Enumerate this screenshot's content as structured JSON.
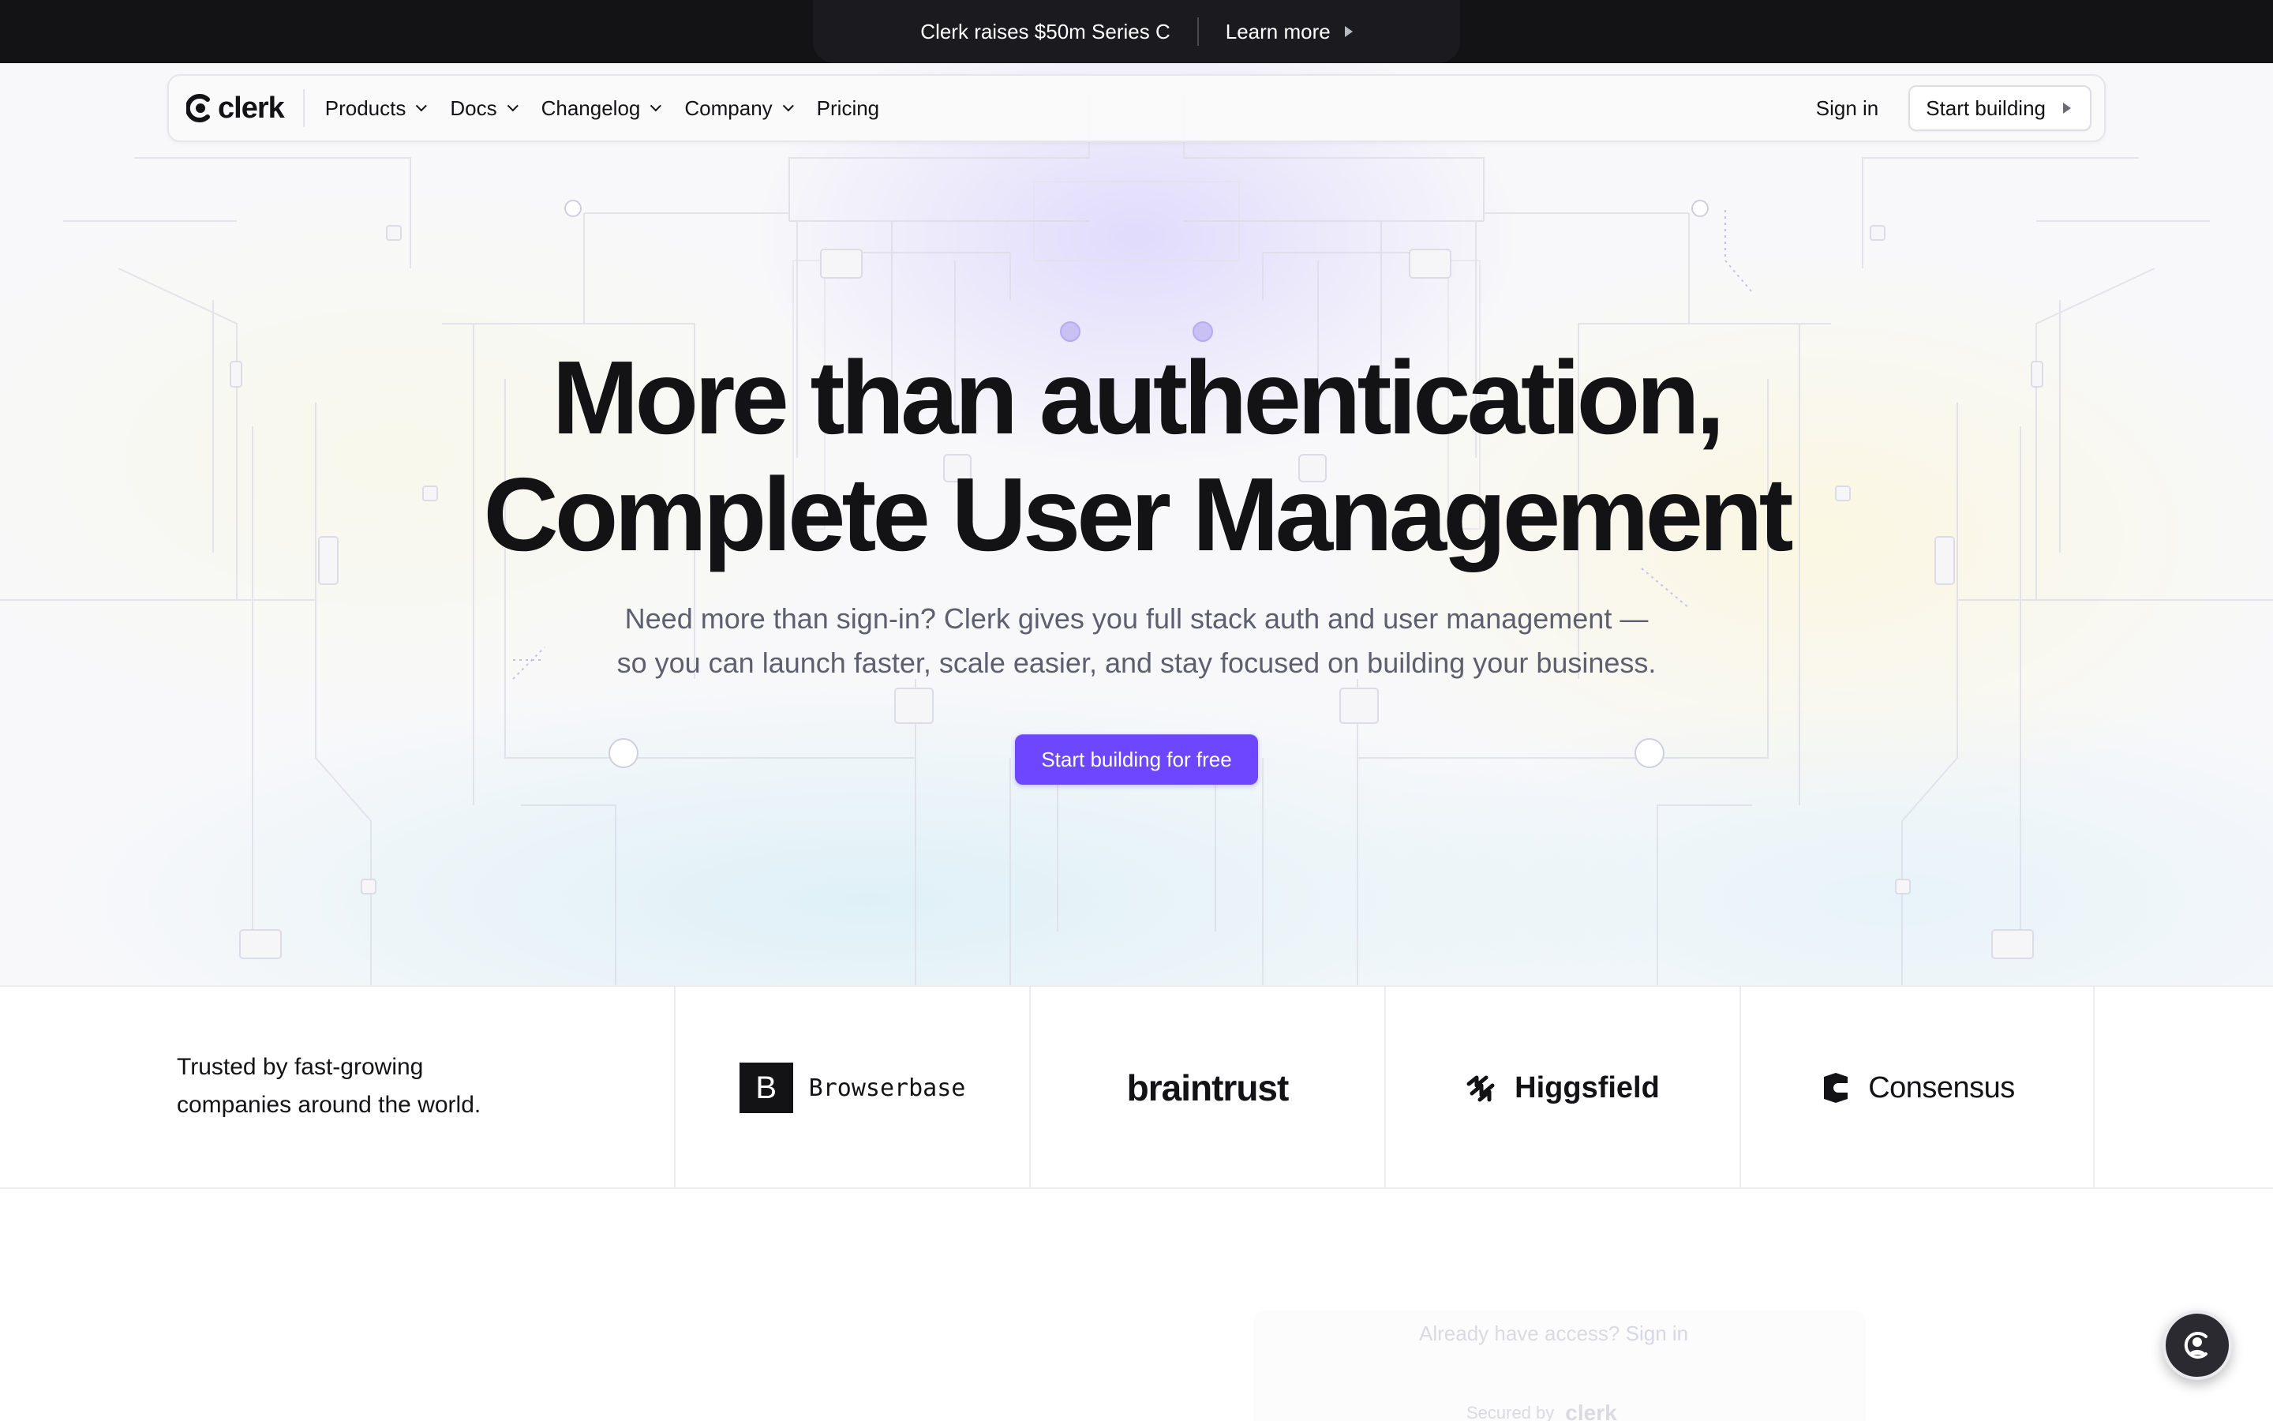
{
  "announcement": {
    "text": "Clerk raises $50m Series C",
    "link": "Learn more"
  },
  "nav": {
    "logo": "clerk",
    "items": [
      {
        "label": "Products",
        "has_menu": true
      },
      {
        "label": "Docs",
        "has_menu": true
      },
      {
        "label": "Changelog",
        "has_menu": true
      },
      {
        "label": "Company",
        "has_menu": true
      },
      {
        "label": "Pricing",
        "has_menu": false
      }
    ],
    "sign_in": "Sign in",
    "start_building": "Start building"
  },
  "hero": {
    "headline_line1": "More than authentication,",
    "headline_line2": "Complete User Management",
    "sub_line1": "Need more than sign-in? Clerk gives you full stack auth and user management —",
    "sub_line2": "so you can launch faster, scale easier, and stay focused on building your business.",
    "cta": "Start building for free"
  },
  "trusted": {
    "line1": "Trusted by fast-growing",
    "line2": "companies around the world.",
    "logos": [
      {
        "name": "Browserbase",
        "mark": "B"
      },
      {
        "name": "braintrust"
      },
      {
        "name": "Higgsfield"
      },
      {
        "name": "Consensus"
      }
    ]
  },
  "below_fold": {
    "access_text": "Already have access?",
    "access_link": "Sign in",
    "secured_by": "Secured by",
    "secured_brand": "clerk"
  },
  "colors": {
    "accent": "#6c47ff",
    "dark": "#131316",
    "muted": "#5e5f6e"
  }
}
